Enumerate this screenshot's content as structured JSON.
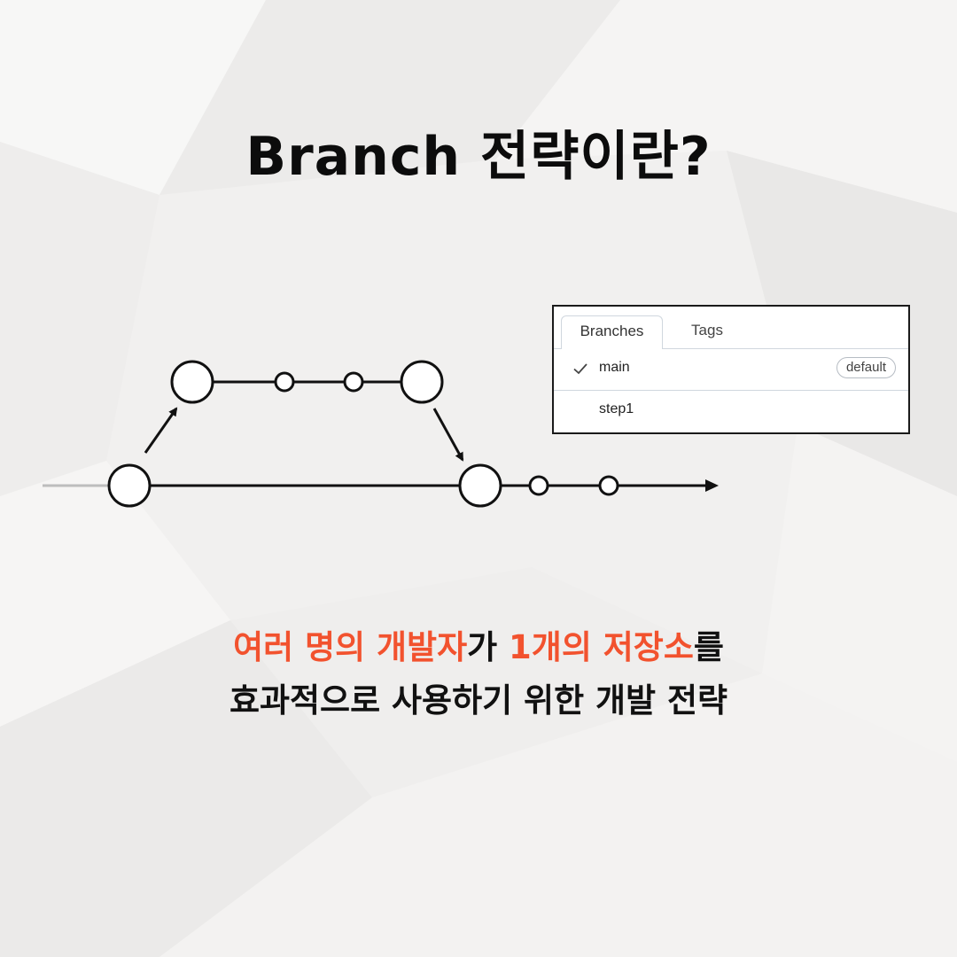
{
  "title": "Branch 전략이란?",
  "branch_panel": {
    "tabs": [
      "Branches",
      "Tags"
    ],
    "branches": [
      {
        "name": "main",
        "badge": "default",
        "checked": true
      },
      {
        "name": "step1",
        "checked": false
      }
    ]
  },
  "description": {
    "line1": {
      "seg1": "여러 명의 개발자",
      "seg2": "가 ",
      "seg3": "1개의 저장소",
      "seg4": "를"
    },
    "line2": "효과적으로 사용하기 위한 개발 전략"
  },
  "colors": {
    "highlight": "#f2522e",
    "text": "#111111",
    "background": "#f1f0ef"
  },
  "icons": [
    "check-icon"
  ]
}
